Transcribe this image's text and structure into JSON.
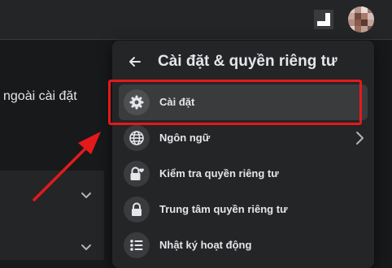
{
  "background": {
    "partial_text": "ngoài cài đặt"
  },
  "panel": {
    "back_icon": "arrow-left-icon",
    "title": "Cài đặt & quyền riêng tư",
    "items": [
      {
        "label": "Cài đặt",
        "icon": "gear-icon",
        "active": true
      },
      {
        "label": "Ngôn ngữ",
        "icon": "globe-icon",
        "has_submenu": true
      },
      {
        "label": "Kiểm tra quyền riêng tư",
        "icon": "lock-heart-icon"
      },
      {
        "label": "Trung tâm quyền riêng tư",
        "icon": "lock-icon"
      },
      {
        "label": "Nhật ký hoạt động",
        "icon": "list-icon"
      }
    ]
  },
  "annotation": {
    "highlight_color": "#e4191c"
  },
  "colors": {
    "page_bg": "#18191a",
    "surface": "#242526",
    "hover": "#3a3b3c",
    "text": "#e4e6eb"
  }
}
